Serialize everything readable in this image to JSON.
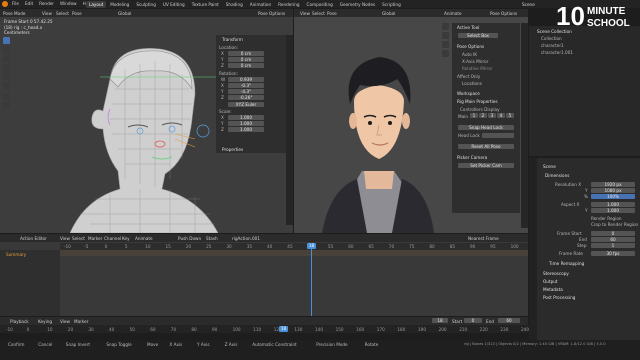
{
  "topbar": {
    "menus": [
      "File",
      "Edit",
      "Render",
      "Window",
      "Help"
    ],
    "workspaces": [
      "Layout",
      "Modeling",
      "Sculpting",
      "UV Editing",
      "Texture Paint",
      "Shading",
      "Animation",
      "Rendering",
      "Compositing",
      "Geometry Nodes",
      "Scripting"
    ],
    "active_workspace": "Layout",
    "scene_label": "Scene"
  },
  "logo": {
    "big": "10",
    "line1": "MINUTE",
    "line2": "SCHOOL"
  },
  "viewport_left": {
    "header_mode": "Pose Mode",
    "header_items": [
      "View",
      "Select",
      "Pose"
    ],
    "orientation": "Global",
    "options": "Pose Options",
    "info_lines": [
      "Frame Start 0 57.42.25",
      "(18) rig : c_head.x",
      "Centimeters"
    ],
    "transform": {
      "title": "Transform",
      "location_label": "Location:",
      "location": [
        [
          "X",
          "0 cm"
        ],
        [
          "Y",
          "0 cm"
        ],
        [
          "Z",
          "0 cm"
        ]
      ],
      "rotation_label": "Rotation:",
      "rotation": [
        [
          "W",
          "0.939"
        ],
        [
          "X",
          "-0.3°"
        ],
        [
          "Y",
          "-4.3°"
        ],
        [
          "Z",
          "-0.26°"
        ]
      ],
      "mode": "XYZ Euler",
      "scale_label": "Scale:",
      "scale": [
        [
          "X",
          "1.000"
        ],
        [
          "Y",
          "1.000"
        ],
        [
          "Z",
          "1.000"
        ]
      ]
    },
    "properties_label": "Properties"
  },
  "viewport_right": {
    "header_items": [
      "View",
      "Select",
      "Pose"
    ],
    "orientation": "Global",
    "animate": "Animate",
    "options": "Pose Options",
    "active_tool": "Active Tool",
    "select_box": "Select Box",
    "pose_options": "Pose Options",
    "checks": [
      "Auto IK",
      "X-Axis Mirror",
      "Relative Mirror",
      "Affect Only",
      "Locations"
    ],
    "workspace": "Workspace",
    "rig_main": "Rig Main Properties",
    "controllers": "Controllers Display",
    "layer_label": "Main",
    "layer_nums": [
      "1",
      "2",
      "3",
      "4",
      "5"
    ],
    "snap_head": "Snap Head Lock",
    "head_lock": "Head Lock",
    "reset_pose": "Reset All Pose",
    "picker": "Picker Camera",
    "set_picker": "Set Picker Cam"
  },
  "timeline_editor": {
    "header": [
      "Action Editor",
      "View",
      "Select",
      "Marker",
      "Channel",
      "Key",
      "Animate"
    ],
    "push_down": "Push Down",
    "stash": "Stash",
    "action": "rigAction.001",
    "summary": "Summary",
    "nearest": "Nearest Frame",
    "ticks": [
      "-10",
      "-5",
      "0",
      "5",
      "10",
      "15",
      "20",
      "25",
      "30",
      "35",
      "40",
      "45",
      "50",
      "55",
      "60",
      "65",
      "70",
      "75",
      "80",
      "85",
      "90",
      "95",
      "100"
    ],
    "current_frame": "18"
  },
  "playback_bar": {
    "items": [
      "Playback",
      "Keying",
      "View",
      "Marker"
    ],
    "frame": "18",
    "start_label": "Start",
    "start": "0",
    "end_label": "End",
    "end": "60",
    "ticks": [
      "-10",
      "0",
      "10",
      "20",
      "30",
      "40",
      "50",
      "60",
      "70",
      "80",
      "90",
      "100",
      "110",
      "120",
      "130",
      "140",
      "150",
      "160",
      "170",
      "180",
      "190",
      "200",
      "210",
      "220",
      "230",
      "240"
    ],
    "scrub_frame": "18"
  },
  "outliner": {
    "title": "Scene Collection",
    "items": [
      "Collection",
      "character1",
      "character1.001"
    ]
  },
  "properties": {
    "scene": "Scene",
    "dimensions": "Dimensions",
    "rows": [
      [
        "Resolution X",
        "1920 px"
      ],
      [
        "Y",
        "1080 px"
      ],
      [
        "%",
        "100%"
      ],
      [
        "Aspect X",
        "1.000"
      ],
      [
        "Y",
        "1.000"
      ]
    ],
    "render_region": "Render Region",
    "crop": "Crop to Render Region",
    "frames": [
      [
        "Frame Start",
        "0"
      ],
      [
        "End",
        "60"
      ],
      [
        "Step",
        "1"
      ]
    ],
    "frame_rate_label": "Frame Rate",
    "frame_rate": "30 fps",
    "sections": [
      "Time Remapping",
      "Stereoscopy",
      "Output",
      "Metadata",
      "Post Processing"
    ]
  },
  "statusbar": {
    "items": [
      "Confirm",
      "Cancel",
      "Snap Invert",
      "Snap Toggle",
      "Move",
      "X Axis",
      "Y Axis",
      "Z Axis",
      "Automatic Constraint",
      "Precision Mode",
      "Rotate"
    ],
    "version": "rig | Bones 1/313 | Objects 0/2 | Memory: 1.45 GiB | VRAM: 1.8/12.0 GiB | 3.0.0"
  },
  "colors": {
    "accent": "#4772b3",
    "playhead": "#4a90d9",
    "orange": "#e8a13b"
  }
}
